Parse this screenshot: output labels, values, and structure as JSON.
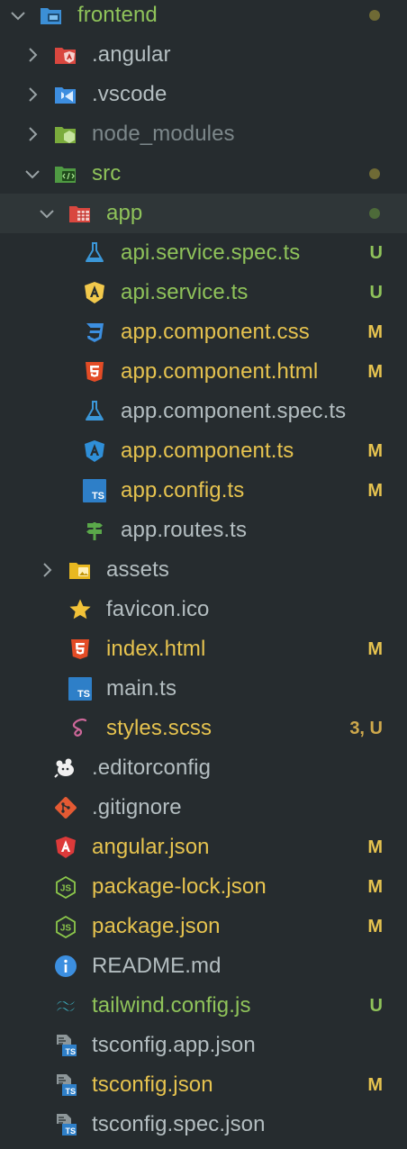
{
  "explorer": {
    "rows": [
      {
        "name": "frontend",
        "level": 0,
        "kind": "folder",
        "expanded": true,
        "icon": "folder-frontend-icon",
        "color": "green",
        "dot": "#6f6a35"
      },
      {
        "name": ".angular",
        "level": 1,
        "kind": "folder",
        "expanded": false,
        "icon": "folder-angular-icon",
        "color": "plain"
      },
      {
        "name": ".vscode",
        "level": 1,
        "kind": "folder",
        "expanded": false,
        "icon": "folder-vscode-icon",
        "color": "plain"
      },
      {
        "name": "node_modules",
        "level": 1,
        "kind": "folder",
        "expanded": false,
        "icon": "folder-node-icon",
        "color": "dim"
      },
      {
        "name": "src",
        "level": 1,
        "kind": "folder",
        "expanded": true,
        "icon": "folder-src-icon",
        "color": "green",
        "dot": "#6f6a35"
      },
      {
        "name": "app",
        "level": 2,
        "kind": "folder",
        "expanded": true,
        "icon": "folder-app-icon",
        "color": "green",
        "dot": "#4d6a39",
        "selected": true
      },
      {
        "name": "api.service.spec.ts",
        "level": 3,
        "kind": "file",
        "icon": "flask-test-icon",
        "color": "green",
        "status": "U"
      },
      {
        "name": "api.service.ts",
        "level": 3,
        "kind": "file",
        "icon": "angular-service-icon",
        "color": "green",
        "status": "U"
      },
      {
        "name": "app.component.css",
        "level": 3,
        "kind": "file",
        "icon": "css-icon",
        "color": "yellow",
        "status": "M"
      },
      {
        "name": "app.component.html",
        "level": 3,
        "kind": "file",
        "icon": "html-icon",
        "color": "yellow",
        "status": "M"
      },
      {
        "name": "app.component.spec.ts",
        "level": 3,
        "kind": "file",
        "icon": "flask-test-icon",
        "color": "plain"
      },
      {
        "name": "app.component.ts",
        "level": 3,
        "kind": "file",
        "icon": "angular-component-icon",
        "color": "yellow",
        "status": "M"
      },
      {
        "name": "app.config.ts",
        "level": 3,
        "kind": "file",
        "icon": "typescript-icon",
        "color": "yellow",
        "status": "M"
      },
      {
        "name": "app.routes.ts",
        "level": 3,
        "kind": "file",
        "icon": "routes-signpost-icon",
        "color": "plain"
      },
      {
        "name": "assets",
        "level": 2,
        "kind": "folder",
        "expanded": false,
        "icon": "folder-assets-icon",
        "color": "plain"
      },
      {
        "name": "favicon.ico",
        "level": 2,
        "kind": "file",
        "icon": "star-icon",
        "color": "plain"
      },
      {
        "name": "index.html",
        "level": 2,
        "kind": "file",
        "icon": "html-icon",
        "color": "yellow",
        "status": "M"
      },
      {
        "name": "main.ts",
        "level": 2,
        "kind": "file",
        "icon": "typescript-icon",
        "color": "plain"
      },
      {
        "name": "styles.scss",
        "level": 2,
        "kind": "file",
        "icon": "sass-icon",
        "color": "yellow",
        "status": "3, U"
      },
      {
        "name": ".editorconfig",
        "level": 1,
        "kind": "file",
        "icon": "editorconfig-mouse-icon",
        "color": "plain"
      },
      {
        "name": ".gitignore",
        "level": 1,
        "kind": "file",
        "icon": "git-icon",
        "color": "plain"
      },
      {
        "name": "angular.json",
        "level": 1,
        "kind": "file",
        "icon": "angular-icon",
        "color": "yellow",
        "status": "M"
      },
      {
        "name": "package-lock.json",
        "level": 1,
        "kind": "file",
        "icon": "nodejs-icon",
        "color": "yellow",
        "status": "M"
      },
      {
        "name": "package.json",
        "level": 1,
        "kind": "file",
        "icon": "nodejs-icon",
        "color": "yellow",
        "status": "M"
      },
      {
        "name": "README.md",
        "level": 1,
        "kind": "file",
        "icon": "info-icon",
        "color": "plain"
      },
      {
        "name": "tailwind.config.js",
        "level": 1,
        "kind": "file",
        "icon": "tailwind-icon",
        "color": "green",
        "status": "U"
      },
      {
        "name": "tsconfig.app.json",
        "level": 1,
        "kind": "file",
        "icon": "tsconfig-icon",
        "color": "plain"
      },
      {
        "name": "tsconfig.json",
        "level": 1,
        "kind": "file",
        "icon": "tsconfig-icon",
        "color": "yellow",
        "status": "M"
      },
      {
        "name": "tsconfig.spec.json",
        "level": 1,
        "kind": "file",
        "icon": "tsconfig-icon",
        "color": "plain"
      }
    ]
  },
  "colors": {
    "background": "#262c2f",
    "selected_row": "#2f3638",
    "green": "#8fc35a",
    "yellow": "#e6c34f",
    "dim": "#7c878a",
    "plain": "#b4bec1",
    "untracked": "#8fc35a",
    "modified": "#e6c34f"
  }
}
